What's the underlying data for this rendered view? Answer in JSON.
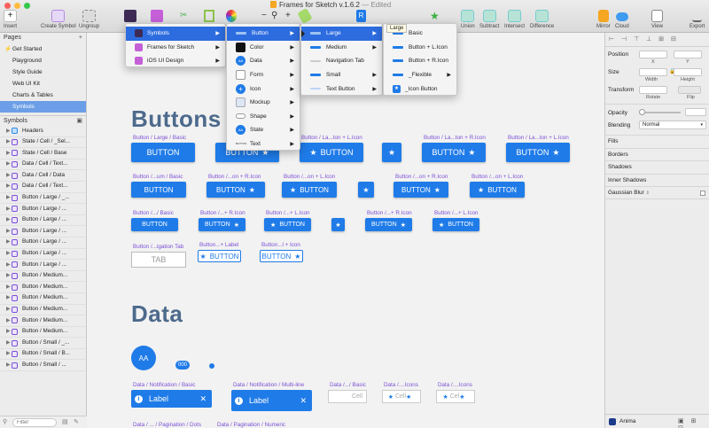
{
  "window": {
    "title": "Frames for Sketch v.1.6.2",
    "edited": "— Edited"
  },
  "toolbar": {
    "insert": "Insert",
    "create_symbol": "Create Symbol",
    "ungroup": "Ungroup",
    "union": "Union",
    "subtract": "Subtract",
    "intersect": "Intersect",
    "difference": "Difference",
    "mirror": "Mirror",
    "cloud": "Cloud",
    "view": "View",
    "export": "Export",
    "zoom_minus": "−",
    "zoom_plus": "+"
  },
  "pages": {
    "header": "Pages",
    "add": "+",
    "items": [
      {
        "label": "Get Started"
      },
      {
        "label": "Playground"
      },
      {
        "label": "Style Guide"
      },
      {
        "label": "Web UI Kit"
      },
      {
        "label": "Charts & Tables"
      },
      {
        "label": "Symbols"
      }
    ]
  },
  "layers": {
    "header": "Symbols",
    "items": [
      {
        "label": "Headers"
      },
      {
        "label": "State / Cell / _Sel..."
      },
      {
        "label": "State / Cell / Base"
      },
      {
        "label": "Data / Cell / Text..."
      },
      {
        "label": "Data / Cell / Data"
      },
      {
        "label": "Data / Cell / Text..."
      },
      {
        "label": "Button / Large / _..."
      },
      {
        "label": "Button / Large / ..."
      },
      {
        "label": "Button / Large / ..."
      },
      {
        "label": "Button / Large / ..."
      },
      {
        "label": "Button / Large / ..."
      },
      {
        "label": "Button / Large / ..."
      },
      {
        "label": "Button / Large / ..."
      },
      {
        "label": "Button / Medium..."
      },
      {
        "label": "Button / Medium..."
      },
      {
        "label": "Button / Medium..."
      },
      {
        "label": "Button / Medium..."
      },
      {
        "label": "Button / Medium..."
      },
      {
        "label": "Button / Medium..."
      },
      {
        "label": "Button / Small / _..."
      },
      {
        "label": "Button / Small / B..."
      },
      {
        "label": "Button / Small / ..."
      }
    ],
    "filter_placeholder": "Filter"
  },
  "canvas": {
    "buttons_title": "Buttons",
    "data_title": "Data",
    "labels": {
      "l1": "Button / Large / Basic",
      "l2": "Button / La...ton + L.Icon",
      "l3": "Button / La...ton + R.Icon",
      "m1": "Button /...um / Basic",
      "m2": "Button /...on + R.Icon",
      "m3": "Button /...on + L.Icon",
      "m4": "Button /...on + R.Icon",
      "m5": "Button /...on + L.Icon",
      "s1": "Button /.../ Basic",
      "s2": "Button /...+ R.Icon",
      "s3": "Button /...+ L.Icon",
      "s4": "Button /...+ R.Icon",
      "s5": "Button /...+ L.Icon",
      "t1": "Button /...igation Tab",
      "t2": "Button...+ Label",
      "t3": "Button...l + Icon",
      "n1": "Data / Notification / Basic",
      "n2": "Data / Notification / Multi-line",
      "c1": "Data /.../ Basic",
      "c2": "Data /....Icons",
      "c3": "Data /....Icons",
      "p1": "Data / ... / Pagination / Dots",
      "p2": "Data / Pagination / Numeric"
    },
    "button_text": "BUTTON",
    "star": "★",
    "tab_text": "TAB",
    "avatar": "AA",
    "badge": "000",
    "label_text": "Label",
    "info_glyph": "i",
    "close_glyph": "✕",
    "cell_text": "Cell",
    "cell_short": "Cel"
  },
  "menus": {
    "plugins": [
      {
        "label": "Symbols"
      },
      {
        "label": "Frames for Sketch"
      },
      {
        "label": "iOS UI Design"
      }
    ],
    "symbols": [
      {
        "label": "Button"
      },
      {
        "label": "Color"
      },
      {
        "label": "Data"
      },
      {
        "label": "Form"
      },
      {
        "label": "Icon"
      },
      {
        "label": "Mockup"
      },
      {
        "label": "Shape"
      },
      {
        "label": "State"
      },
      {
        "label": "Text"
      }
    ],
    "symbols_badges": {
      "data": "AA",
      "state": "AA",
      "text": "BUTTON"
    },
    "button": [
      {
        "label": "Large"
      },
      {
        "label": "Medium"
      },
      {
        "label": "Navigation Tab"
      },
      {
        "label": "Small"
      },
      {
        "label": "Text Button"
      }
    ],
    "large": [
      {
        "label": "Basic"
      },
      {
        "label": "Button + L.Icon"
      },
      {
        "label": "Button + R.Icon"
      },
      {
        "label": "_Flexible"
      },
      {
        "label": "_Icon Button"
      }
    ],
    "tooltip": "Large"
  },
  "inspector": {
    "position": "Position",
    "size": "Size",
    "transform": "Transform",
    "x": "X",
    "y": "Y",
    "width": "Width",
    "height": "Height",
    "rotate": "Rotate",
    "flip": "Flip",
    "opacity": "Opacity",
    "blending": "Blending",
    "blending_value": "Normal",
    "fills": "Fills",
    "borders": "Borders",
    "shadows": "Shadows",
    "inner_shadows": "Inner Shadows",
    "gaussian_blur": "Gaussian Blur",
    "anima": "Anima"
  },
  "colors": {
    "accent": "#1f7be8",
    "section_title": "#4d6a8c",
    "label": "#7b4fd6",
    "menu_highlight": "#2d6cdf",
    "page_selected": "#6b9ee6"
  }
}
